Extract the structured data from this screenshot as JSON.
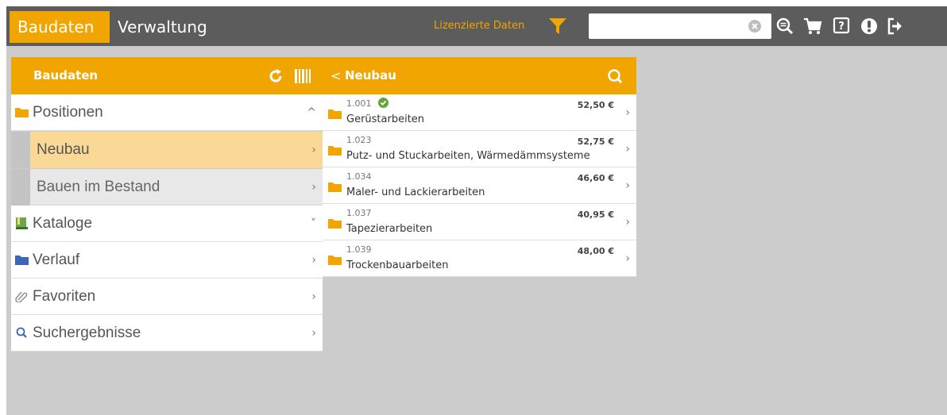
{
  "topbar": {
    "nav_active": "Baudaten",
    "nav_other": "Verwaltung",
    "licensed_label": "Lizenzierte Daten",
    "search_value": "",
    "search_placeholder": "",
    "accent_color": "#f0a500",
    "bar_color": "#5c5c5c",
    "icons": [
      "filter-icon",
      "clear-icon",
      "zoom-search-icon",
      "cart-icon",
      "help-icon",
      "user-icon",
      "logout-icon"
    ]
  },
  "left_panel": {
    "title": "Baudaten",
    "items": [
      {
        "label": "Positionen",
        "icon": "folder-icon",
        "chevron": "^"
      },
      {
        "label": "Kataloge",
        "icon": "catalog-icon",
        "chevron": "˅"
      },
      {
        "label": "Verlauf",
        "icon": "folder-blue-icon",
        "chevron": "›"
      },
      {
        "label": "Favoriten",
        "icon": "paperclip-icon",
        "chevron": "›"
      },
      {
        "label": "Suchergebnisse",
        "icon": "search-icon",
        "chevron": "›"
      }
    ],
    "sub_items": [
      {
        "label": "Neubau",
        "active": true,
        "chevron": "›"
      },
      {
        "label": "Bauen im Bestand",
        "active": false,
        "chevron": "›"
      }
    ]
  },
  "right_panel": {
    "title": "Neubau",
    "items": [
      {
        "number": "1.001",
        "name": "Gerüstarbeiten",
        "price": "52,50 €",
        "checked": true
      },
      {
        "number": "1.023",
        "name": "Putz- und Stuckarbeiten, Wärmedämmsysteme",
        "price": "52,75 €",
        "checked": false
      },
      {
        "number": "1.034",
        "name": "Maler- und Lackierarbeiten",
        "price": "46,60 €",
        "checked": false
      },
      {
        "number": "1.037",
        "name": "Tapezierarbeiten",
        "price": "40,95 €",
        "checked": false
      },
      {
        "number": "1.039",
        "name": "Trockenbauarbeiten",
        "price": "48,00 €",
        "checked": false
      }
    ]
  }
}
